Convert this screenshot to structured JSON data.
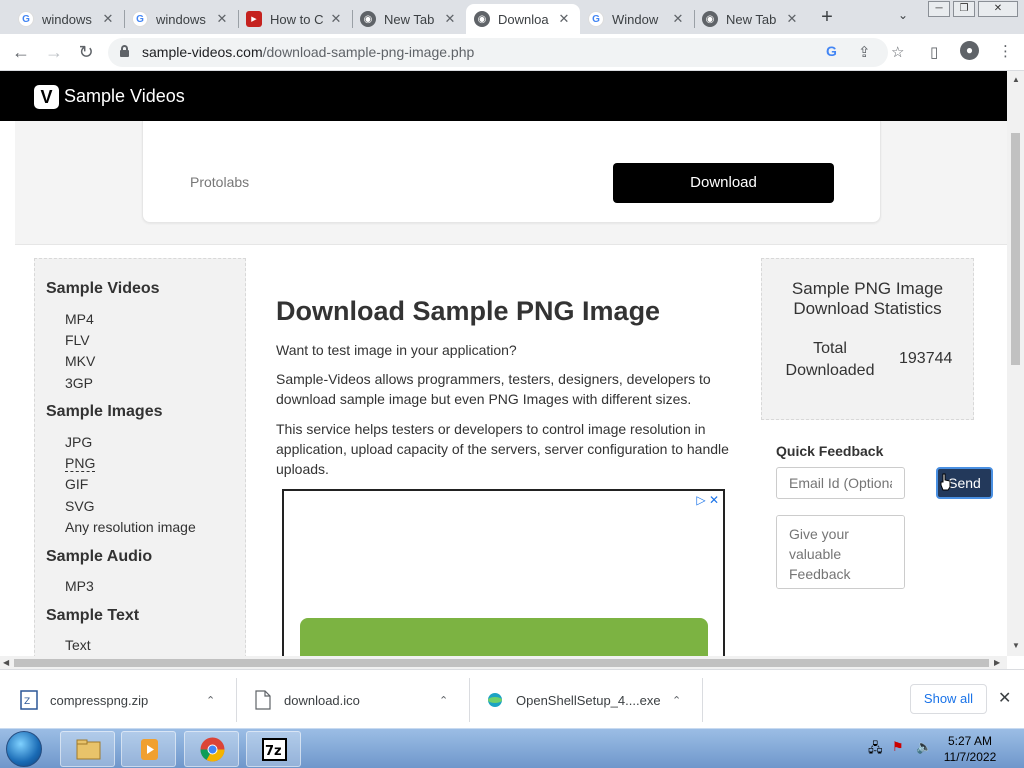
{
  "browser": {
    "tabs": [
      {
        "title": "windows",
        "icon": "google-icon",
        "active": false
      },
      {
        "title": "windows",
        "icon": "google-icon",
        "active": false
      },
      {
        "title": "How to C",
        "icon": "red-site-icon",
        "active": false
      },
      {
        "title": "New Tab",
        "icon": "chrome-icon",
        "active": false
      },
      {
        "title": "Downloa",
        "icon": "globe-icon",
        "active": true
      },
      {
        "title": "Window",
        "icon": "google-icon",
        "active": false
      },
      {
        "title": "New Tab",
        "icon": "chrome-icon",
        "active": false
      }
    ],
    "url_host": "sample-videos.com",
    "url_path": "/download-sample-png-image.php"
  },
  "site": {
    "logo_letter": "V",
    "logo_text": "Sample Videos"
  },
  "ad_banner": {
    "brand": "Protolabs",
    "button": "Download"
  },
  "sidebar": {
    "sections": [
      {
        "heading": "Sample Videos",
        "items": [
          "MP4",
          "FLV",
          "MKV",
          "3GP"
        ]
      },
      {
        "heading": "Sample Images",
        "items": [
          "JPG",
          "PNG",
          "GIF",
          "SVG",
          "Any resolution image"
        ]
      },
      {
        "heading": "Sample Audio",
        "items": [
          "MP3"
        ]
      },
      {
        "heading": "Sample Text",
        "items": [
          "Text"
        ]
      }
    ],
    "current_item": "PNG"
  },
  "main": {
    "title": "Download Sample PNG Image",
    "paragraphs": [
      "Want to test image in your application?",
      "Sample-Videos allows programmers, testers, designers, developers to download sample image but even PNG Images with different sizes.",
      "This service helps testers or developers to control image resolution in application, upload capacity of the servers, server configuration to handle uploads."
    ]
  },
  "stats": {
    "title": "Sample PNG Image Download Statistics",
    "label": "Total Downloaded",
    "value": "193744"
  },
  "feedback": {
    "title": "Quick Feedback",
    "email_placeholder": "Email Id (Optional)",
    "send": "Send",
    "text_placeholder": "Give your valuable Feedback"
  },
  "downloads": {
    "items": [
      "compresspng.zip",
      "download.ico",
      "OpenShellSetup_4....exe"
    ],
    "show_all": "Show all"
  },
  "taskbar": {
    "time": "5:27 AM",
    "date": "11/7/2022"
  },
  "colors": {
    "header_bg": "#000000",
    "sidebar_bg": "#f2f2f2",
    "link_blue": "#1a73e8",
    "send_bg": "#23395b"
  }
}
